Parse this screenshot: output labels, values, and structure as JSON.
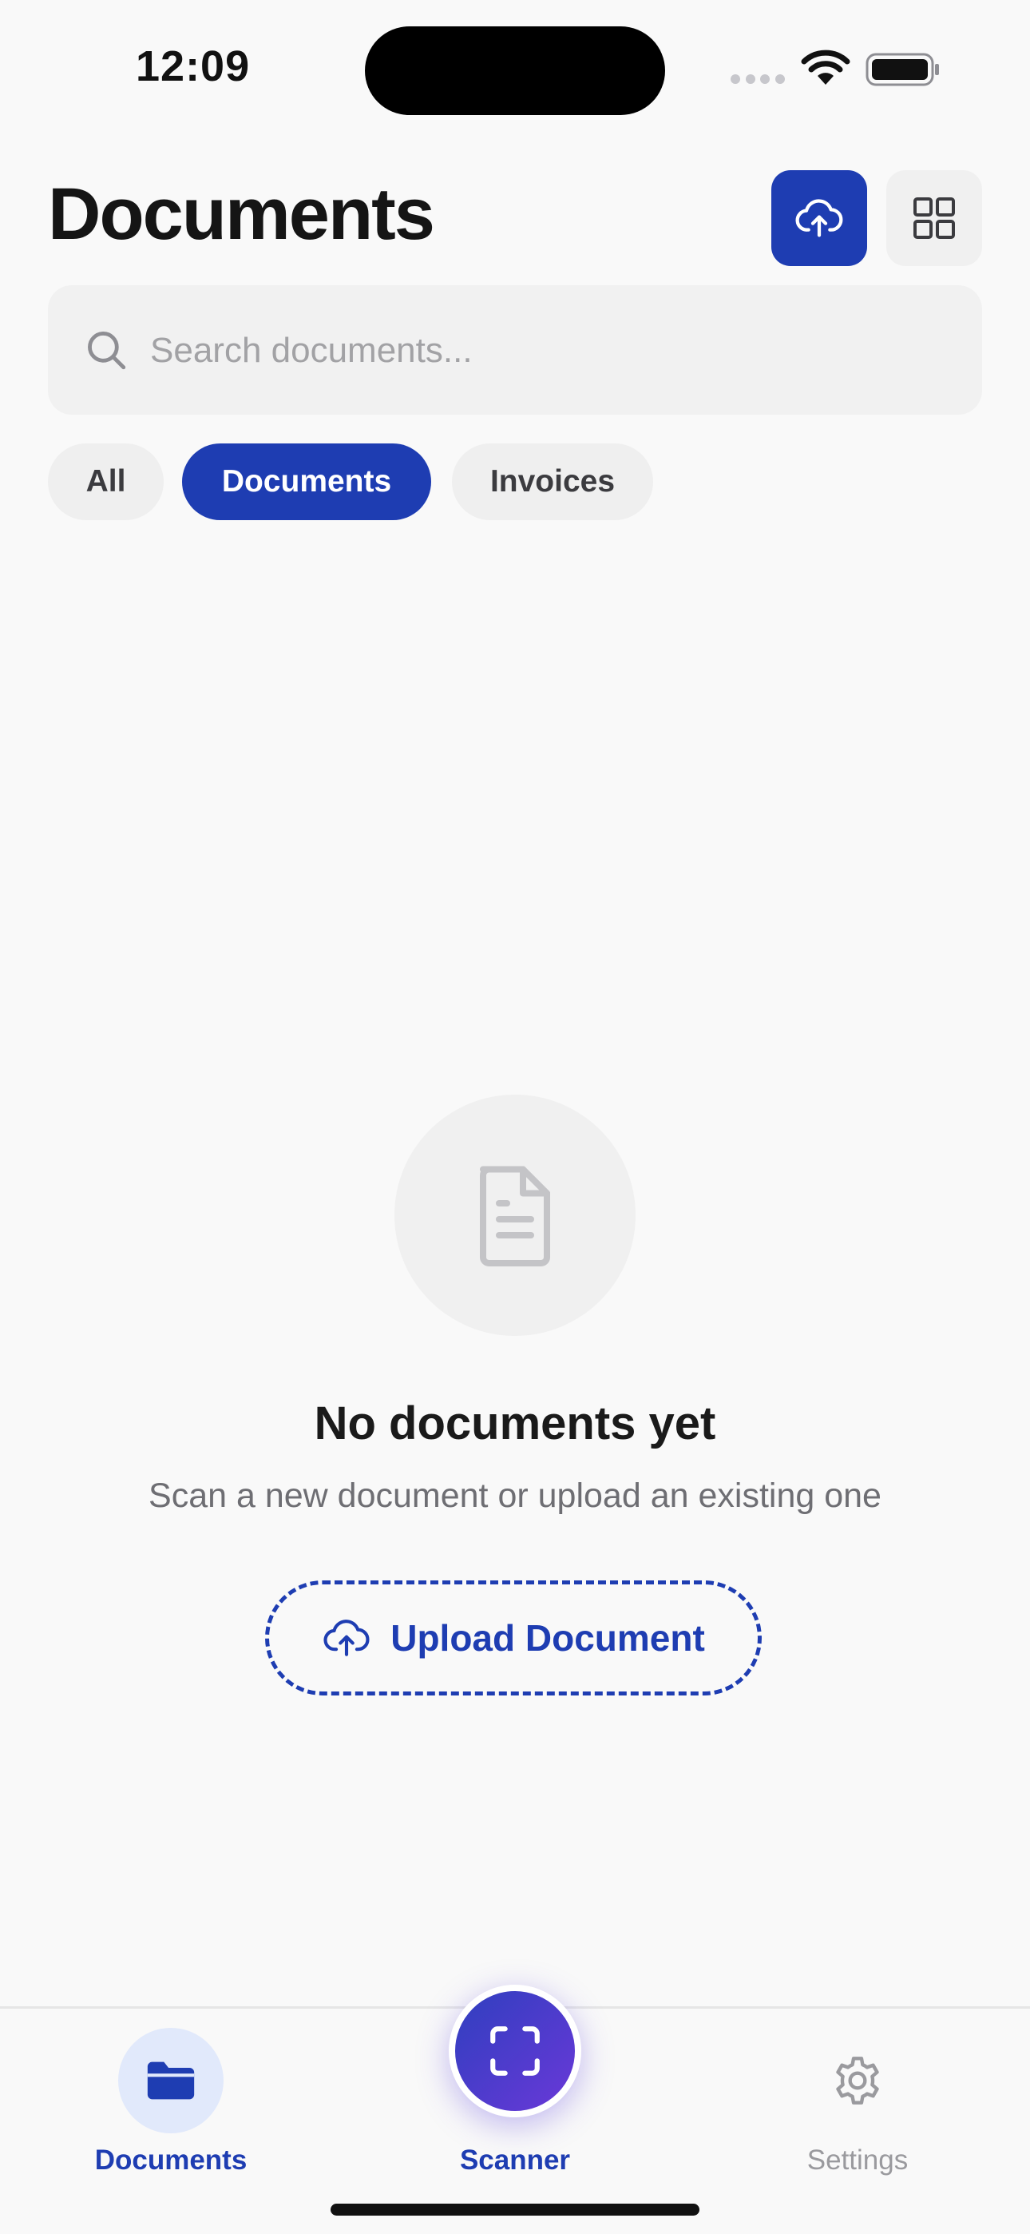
{
  "status_bar": {
    "time": "12:09"
  },
  "header": {
    "title": "Documents",
    "upload_button_icon": "cloud-upload-icon",
    "grid_button_icon": "grid-icon"
  },
  "search": {
    "placeholder": "Search documents...",
    "value": ""
  },
  "filters": {
    "items": [
      {
        "label": "All",
        "selected": false
      },
      {
        "label": "Documents",
        "selected": true
      },
      {
        "label": "Invoices",
        "selected": false
      }
    ]
  },
  "empty_state": {
    "icon": "document-icon",
    "title": "No documents yet",
    "subtitle": "Scan a new document or upload an existing one",
    "button_label": "Upload Document"
  },
  "tab_bar": {
    "items": [
      {
        "label": "Documents",
        "icon": "folder-icon",
        "active": true
      },
      {
        "label": "Scanner",
        "icon": "scan-icon",
        "active": false
      },
      {
        "label": "Settings",
        "icon": "gear-icon",
        "active": false
      }
    ]
  },
  "colors": {
    "accent": "#1e3db2",
    "background": "#f9f9f9",
    "chip_inactive": "#efefef",
    "scanner_gradient_start": "#2f3fbf",
    "scanner_gradient_end": "#6a38d8"
  }
}
